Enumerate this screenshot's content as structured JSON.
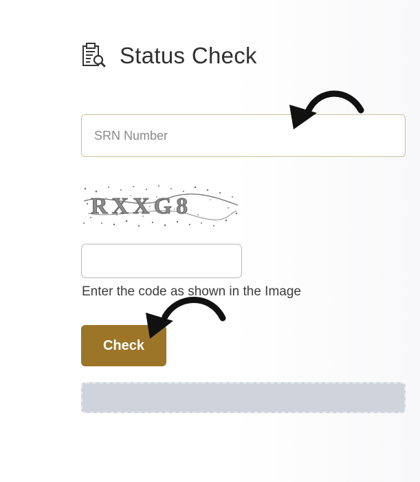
{
  "header": {
    "title": "Status Check",
    "icon": "report-search-icon"
  },
  "form": {
    "srn_placeholder": "SRN Number",
    "srn_value": "",
    "captcha_text": "RXXG8",
    "captcha_input_value": "",
    "helper_text": "Enter the code as shown in the Image",
    "check_label": "Check"
  },
  "colors": {
    "accent": "#9c7529",
    "input_border": "#c9c19a",
    "result_box": "#cfd3dc",
    "arrow": "#111111"
  },
  "annotations": [
    {
      "icon": "pointer-arrow-icon",
      "target": "srn-input"
    },
    {
      "icon": "pointer-arrow-icon",
      "target": "check-button"
    }
  ]
}
